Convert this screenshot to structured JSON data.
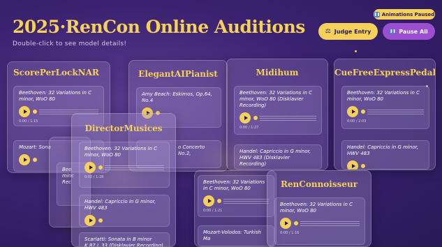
{
  "header": {
    "title": "2025·RenCon Online Auditions",
    "subtitle": "Double-click to see model details!"
  },
  "badge": {
    "label": "Animations Paused",
    "icon": "pause-icon"
  },
  "buttons": {
    "judge": {
      "label": "Judge Entry",
      "icon": "gavel-icon"
    },
    "pause": {
      "label": "Pause All",
      "icon": "pause-icon"
    }
  },
  "cards": {
    "scoreperlock": {
      "title": "ScorePerLockNAR",
      "pieces": [
        {
          "name": "Beethoven: 32 Variations in C minor, WoO 80",
          "time": "0:00 / 1:15"
        },
        {
          "name": "Mozart: Sona"
        }
      ]
    },
    "elegant": {
      "title": "ElegantAIPianist",
      "pieces": [
        {
          "name": "Amy Beach: Eskimos, Op.64, No.4"
        },
        {
          "name": "o Concerto No.2,"
        }
      ]
    },
    "midihum": {
      "title": "Midihum",
      "pieces": [
        {
          "name": "Beethoven: 32 Variations in C minor, WoO 80 (Disklavier Recording)",
          "time": "0:00 / 1:27"
        },
        {
          "name": "Handel: Capriccio in G minor, HWV 483 (Disklavier Recording)"
        }
      ]
    },
    "cuefree": {
      "title": "CueFreeExpressPedal",
      "pieces": [
        {
          "name": "Beethoven: 32 Variations in C minor, WoO 80",
          "time": "0:00 / 2:03"
        },
        {
          "name": "Handel: Capriccio in G minor, HWV 483"
        }
      ]
    },
    "hidden": {
      "pieces": [
        {
          "name": "Bee minc Rec"
        }
      ]
    },
    "director": {
      "title": "DirectorMusices",
      "pieces": [
        {
          "name": "Beethoven: 32 Variations in C minor, WoO 80",
          "time": "0:00 / 1:28"
        },
        {
          "name": "Handel: Capriccio in G minor, HWV 483"
        },
        {
          "name": "Scarlatti: Sonata in B minor K.87 L.33 (Disklavier Recording)"
        }
      ]
    },
    "middle": {
      "pieces": [
        {
          "name": "Beethoven: 32 Variations in C minor, WoO 80",
          "time": "0:00 / 1:21"
        },
        {
          "name": "Mozart-Volodos: Turkish Ma"
        }
      ]
    },
    "renconnoisseur": {
      "title": "RenConnoisseur",
      "pieces": [
        {
          "name": "Beethoven: 32 Variations in C minor, WoO 80",
          "time": "0:00 / 1:16"
        }
      ]
    }
  }
}
